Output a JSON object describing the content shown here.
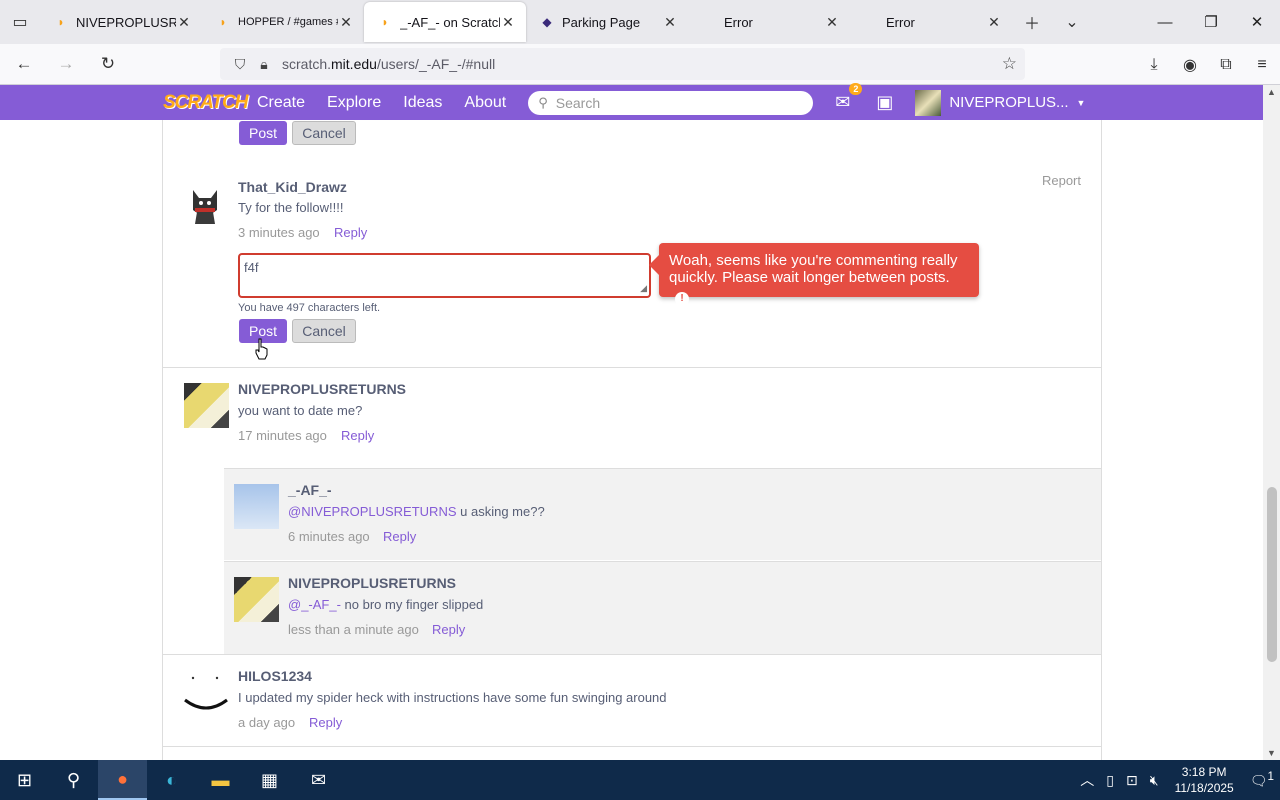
{
  "browser": {
    "tabs": [
      {
        "title": "NIVEPROPLUSRETURNS",
        "active": false
      },
      {
        "title": "HOPPER / #games #tiktok",
        "active": false
      },
      {
        "title": "_-AF_- on Scratch",
        "active": true
      },
      {
        "title": "Parking Page",
        "active": false
      },
      {
        "title": "Error",
        "active": false
      },
      {
        "title": "Error",
        "active": false
      }
    ],
    "url_prefix": "scratch.",
    "url_domain": "mit.edu",
    "url_path": "/users/_-AF_-/#null"
  },
  "scratch_header": {
    "logo": "SCRATCH",
    "nav": [
      "Create",
      "Explore",
      "Ideas",
      "About"
    ],
    "search_placeholder": "Search",
    "message_count": "2",
    "username": "NIVEPROPLUS..."
  },
  "top_form": {
    "post_label": "Post",
    "cancel_label": "Cancel"
  },
  "comments": {
    "c1": {
      "author": "That_Kid_Drawz",
      "text": "Ty for the follow!!!!",
      "time": "3 minutes ago",
      "reply": "Reply",
      "report": "Report"
    },
    "reply_form": {
      "value": "f4f",
      "chars_left": "You have 497 characters left.",
      "post_label": "Post",
      "cancel_label": "Cancel",
      "error": "Woah, seems like you're commenting really quickly. Please wait longer between posts.",
      "error_icon": "!"
    },
    "c2": {
      "author": "NIVEPROPLUSRETURNS",
      "text": "you want to date me?",
      "time": "17 minutes ago",
      "reply": "Reply"
    },
    "c2r1": {
      "author": "_-AF_-",
      "mention": "@NIVEPROPLUSRETURNS",
      "text": " u asking me??",
      "time": "6 minutes ago",
      "reply": "Reply"
    },
    "c2r2": {
      "author": "NIVEPROPLUSRETURNS",
      "mention": "@_-AF_-",
      "text": " no bro my finger slipped",
      "time": "less than a minute ago",
      "reply": "Reply"
    },
    "c3": {
      "author": "HILOS1234",
      "text": "I updated my spider heck with instructions have some fun swinging around",
      "time": "a day ago",
      "reply": "Reply"
    }
  },
  "taskbar": {
    "time": "3:18 PM",
    "date": "11/18/2025",
    "notifications": "1"
  }
}
